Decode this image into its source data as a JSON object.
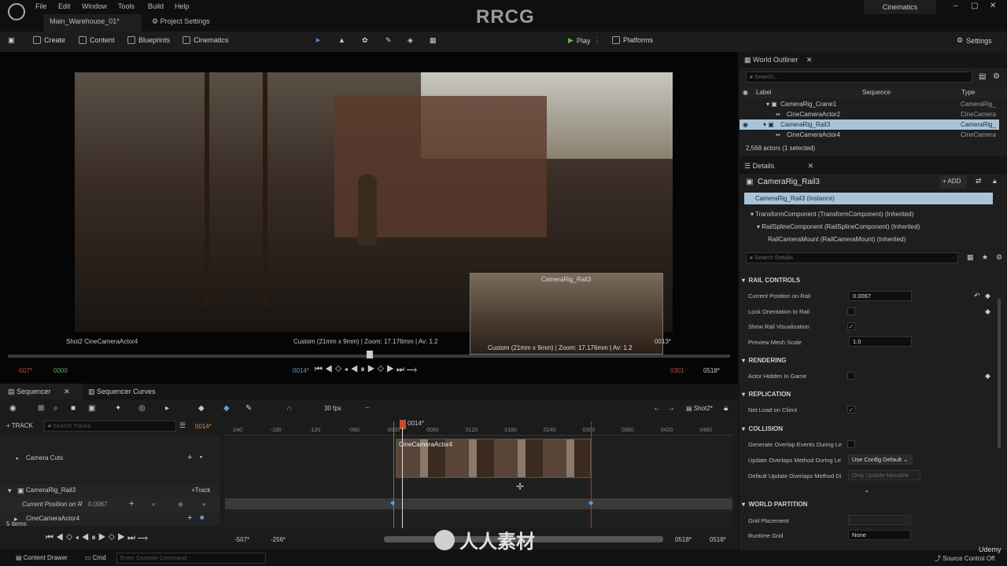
{
  "menu": [
    "File",
    "Edit",
    "Window",
    "Tools",
    "Build",
    "Help"
  ],
  "tabs": {
    "level": "Main_Warehouse_01*",
    "project_settings": "Project Settings"
  },
  "top_right": {
    "mode": "Cinematics"
  },
  "watermark": "RRCG",
  "toolbar": {
    "create": "Create",
    "content": "Content",
    "blueprints": "Blueprints",
    "cinematics": "Cinematics",
    "play": "Play",
    "platforms": "Platforms",
    "settings": "Settings"
  },
  "viewport": {
    "pip_label": "CameraRig_Rail3",
    "pip_info": "Custom (21mm x 9mm) | Zoom: 17.176mm | Av: 1.2",
    "shot_label": "Shot2 CineCameraActor4",
    "info": "Custom (21mm x 9mm) | Zoom: 17.176mm | Av: 1.2",
    "frame": "0013*",
    "start_red": "-507*",
    "start_green": "0000",
    "current": "0014*",
    "end_red": "0301",
    "end": "0518*"
  },
  "outliner": {
    "title": "World Outliner",
    "search_placeholder": "Search...",
    "col_label": "Label",
    "col_sequence": "Sequence",
    "col_type": "Type",
    "rows": [
      {
        "label": "CameraRig_Crane1",
        "type": "CameraRig_"
      },
      {
        "label": "CineCameraActor2",
        "type": "CineCamera"
      },
      {
        "label": "CameraRig_Rail3",
        "type": "CameraRig_"
      },
      {
        "label": "CineCameraActor4",
        "type": "CineCamera"
      }
    ],
    "count": "2,568 actors (1 selected)"
  },
  "details": {
    "title": "Details",
    "actor": "CameraRig_Rail3",
    "add": "ADD",
    "instance": "CameraRig_Rail3 (Instance)",
    "components": [
      "TransformComponent (TransformComponent) (Inherited)",
      "RailSplineComponent (RailSplineComponent) (Inherited)",
      "RailCameraMount (RailCameraMount) (Inherited)"
    ],
    "search_placeholder": "Search Details",
    "sections": {
      "rail": "RAIL CONTROLS",
      "rendering": "RENDERING",
      "replication": "REPLICATION",
      "collision": "COLLISION",
      "world_partition": "WORLD PARTITION"
    },
    "props": {
      "current_position_label": "Current Position on Rail",
      "current_position": "0.0067",
      "lock_orientation": "Lock Orientation to Rail",
      "show_rail": "Show Rail Visualization",
      "preview_scale_label": "Preview Mesh Scale",
      "preview_scale": "1.0",
      "actor_hidden": "Actor Hidden In Game",
      "net_load": "Net Load on Client",
      "gen_overlap": "Generate Overlap Events During Le",
      "update_overlaps_label": "Update Overlaps Method During Le",
      "update_overlaps": "Use Config Default",
      "default_update_label": "Default Update Overlaps Method Di",
      "default_update": "Only Update Movable",
      "grid_placement": "Grid Placement",
      "runtime_grid_label": "Runtime Grid",
      "runtime_grid": "None"
    }
  },
  "sequencer": {
    "tab": "Sequencer",
    "tab2": "Sequencer Curves",
    "fps": "30 fps",
    "shot": "Shot2*",
    "track_btn": "TRACK",
    "search_placeholder": "Search Tracks",
    "current_frame": "0014*",
    "playhead": "0014*",
    "ruler": [
      "-240",
      "-180",
      "-120",
      "-060",
      "0000",
      "0060",
      "0120",
      "0180",
      "0240",
      "0300",
      "0360",
      "0420",
      "0480"
    ],
    "tracks": {
      "camera_cuts": "Camera Cuts",
      "rig": "CameraRig_Rail3",
      "track": "Track",
      "param": "Current Position on R",
      "param_value": "0.0067",
      "cine": "CineCameraActor4"
    },
    "clip": "CineCameraActor4",
    "items": "5 items",
    "bottom": {
      "left_a": "-507*",
      "left_b": "-256*",
      "right_a": "0518*",
      "right_b": "0518*"
    }
  },
  "statusbar": {
    "content_drawer": "Content Drawer",
    "cmd": "Cmd",
    "console_placeholder": "Enter Console Command",
    "source_control": "Source Control Off"
  },
  "brand": {
    "site": "人人素材",
    "udemy": "Udemy"
  }
}
